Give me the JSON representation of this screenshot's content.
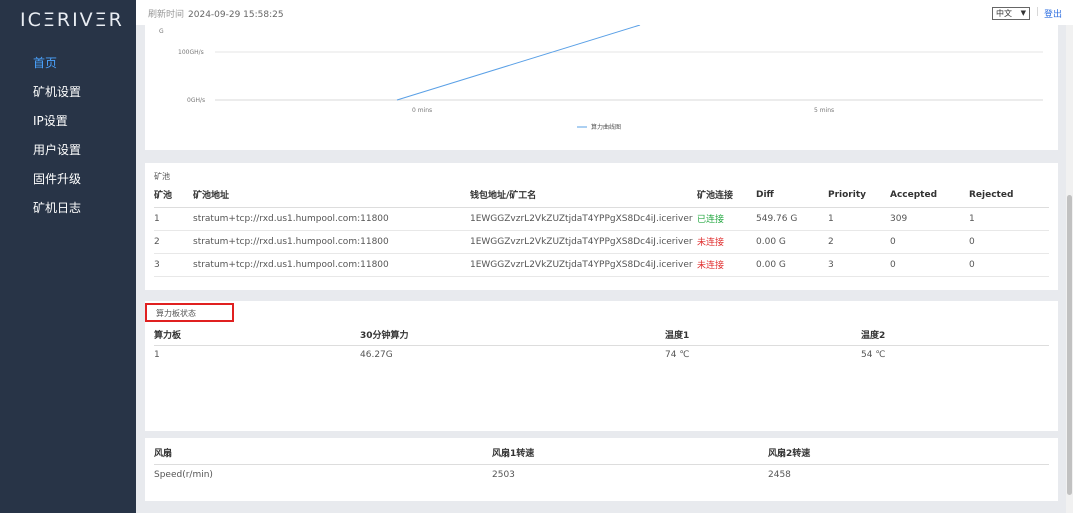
{
  "sidebar": {
    "logo": {
      "part1": "IC",
      "accent": "≡",
      "part2": "RIV",
      "accent2": "≡",
      "part3": "R"
    },
    "items": [
      {
        "label": "首页",
        "active": true
      },
      {
        "label": "矿机设置",
        "active": false
      },
      {
        "label": "IP设置",
        "active": false
      },
      {
        "label": "用户设置",
        "active": false
      },
      {
        "label": "固件升级",
        "active": false
      },
      {
        "label": "矿机日志",
        "active": false
      }
    ]
  },
  "topbar": {
    "refresh_label": "刷新时间",
    "refresh_time": "2024-09-29 15:58:25",
    "language": "中文",
    "separator": "|",
    "logout": "登出"
  },
  "chart_data": {
    "type": "line",
    "partial_top_label": "G",
    "y_ticks": [
      "100GH/s",
      "0GH/s"
    ],
    "x_ticks": [
      "0 mins",
      "5 mins"
    ],
    "legend": "算力曲线图",
    "series_color": "#5aa0e6"
  },
  "pools": {
    "title": "矿池",
    "headers": [
      "矿池",
      "矿池地址",
      "钱包地址/矿工名",
      "矿池连接",
      "Diff",
      "Priority",
      "Accepted",
      "Rejected"
    ],
    "rows": [
      [
        "1",
        "stratum+tcp://rxd.us1.humpool.com:11800",
        "1EWGGZvzrL2VkZUZtjdaT4YPPgXS8Dc4iJ.iceriver",
        "已连接",
        "549.76 G",
        "1",
        "309",
        "1"
      ],
      [
        "2",
        "stratum+tcp://rxd.us1.humpool.com:11800",
        "1EWGGZvzrL2VkZUZtjdaT4YPPgXS8Dc4iJ.iceriver",
        "未连接",
        "0.00 G",
        "2",
        "0",
        "0"
      ],
      [
        "3",
        "stratum+tcp://rxd.us1.humpool.com:11800",
        "1EWGGZvzrL2VkZUZtjdaT4YPPgXS8Dc4iJ.iceriver",
        "未连接",
        "0.00 G",
        "3",
        "0",
        "0"
      ]
    ],
    "status_colors": {
      "已连接": "#27a944",
      "未连接": "#e03030"
    }
  },
  "boards": {
    "title": "算力板状态",
    "headers": [
      "算力板",
      "30分钟算力",
      "温度1",
      "温度2"
    ],
    "rows": [
      [
        "1",
        "46.27G",
        "74 ℃",
        "54 ℃"
      ]
    ]
  },
  "fans": {
    "headers": [
      "风扇",
      "风扇1转速",
      "风扇2转速"
    ],
    "rows": [
      [
        "Speed(r/min)",
        "2503",
        "2458"
      ]
    ]
  }
}
